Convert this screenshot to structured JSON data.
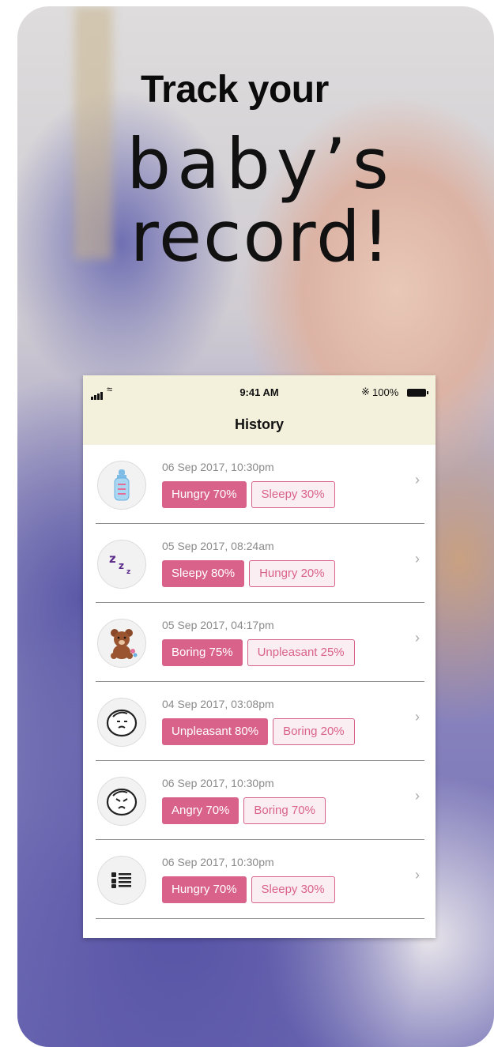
{
  "headline": {
    "bold": "Track your",
    "line1": "baby’s",
    "line2": "record!"
  },
  "status_bar": {
    "time": "9:41 AM",
    "battery": "100%"
  },
  "nav": {
    "title": "History"
  },
  "records": [
    {
      "icon": "bottle-icon",
      "date": "06 Sep 2017, 10:30pm",
      "primary": "Hungry 70%",
      "secondary": "Sleepy 30%"
    },
    {
      "icon": "zzz-icon",
      "date": "05 Sep 2017, 08:24am",
      "primary": "Sleepy 80%",
      "secondary": "Hungry 20%"
    },
    {
      "icon": "teddy-bear-icon",
      "date": "05 Sep 2017, 04:17pm",
      "primary": "Boring 75%",
      "secondary": "Unpleasant 25%"
    },
    {
      "icon": "baby-face-icon",
      "date": "04 Sep 2017, 03:08pm",
      "primary": "Unpleasant 80%",
      "secondary": "Boring 20%"
    },
    {
      "icon": "angry-baby-icon",
      "date": "06 Sep 2017, 10:30pm",
      "primary": "Angry 70%",
      "secondary": "Boring 70%"
    },
    {
      "icon": "list-icon",
      "date": "06 Sep 2017, 10:30pm",
      "primary": "Hungry 70%",
      "secondary": "Sleepy 30%"
    }
  ],
  "colors": {
    "accent": "#d9628b",
    "nav_bg": "#f3f1dc"
  }
}
